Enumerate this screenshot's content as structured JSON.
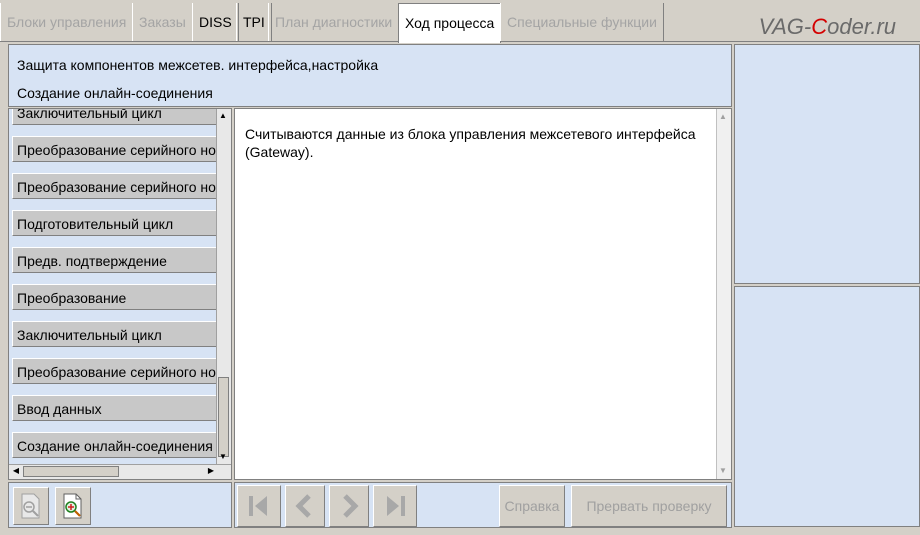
{
  "tabs": [
    {
      "label": "Блоки управления",
      "state": "disabled"
    },
    {
      "label": "Заказы",
      "state": "disabled"
    },
    {
      "label": "DISS",
      "state": "enabled"
    },
    {
      "label": "TPI",
      "state": "enabled"
    },
    {
      "label": "План диагностики",
      "state": "disabled"
    },
    {
      "label": "Ход процесса",
      "state": "current"
    },
    {
      "label": "Специальные функции",
      "state": "disabled"
    }
  ],
  "brand": {
    "prefix": "VAG-",
    "accent": "C",
    "suffix": "oder.ru"
  },
  "header": {
    "line1": "Защита компонентов межсетев. интерфейса,настройка",
    "line2": "Создание онлайн-соединения"
  },
  "steps": [
    "Заключительный цикл",
    "Преобразование серийного но",
    "Преобразование серийного но",
    "Подготовительный цикл",
    "Предв. подтверждение",
    "Преобразование",
    "Заключительный цикл",
    "Преобразование серийного но",
    "Ввод данных",
    "Создание онлайн-соединения"
  ],
  "content": {
    "message": "Считываются данные из блока управления межсетевого интерфейса (Gateway)."
  },
  "buttons": {
    "help": "Справка",
    "abort": "Прервать проверку"
  },
  "colors": {
    "panel": "#d7e3f4",
    "accent_brand": "#d40000"
  }
}
